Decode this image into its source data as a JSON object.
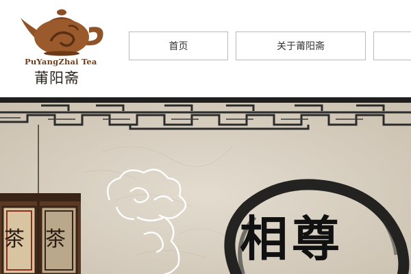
{
  "logo": {
    "name_en": "PuYangZhai Tea",
    "name_cn": "莆阳斋",
    "icon": "teapot-icon",
    "colors": {
      "teapot": "#9a5a2b",
      "teapot_dark": "#6b3a17"
    }
  },
  "nav": {
    "items": [
      {
        "label": "首页"
      },
      {
        "label": "关于莆阳斋"
      },
      {
        "label": ""
      }
    ]
  },
  "banner": {
    "lantern_chars": [
      "茶",
      "茶"
    ],
    "calligraphy": "相尊",
    "colors": {
      "paper": "#d9d1c3",
      "ink": "#111111",
      "frame": "#2b2b2b"
    }
  }
}
